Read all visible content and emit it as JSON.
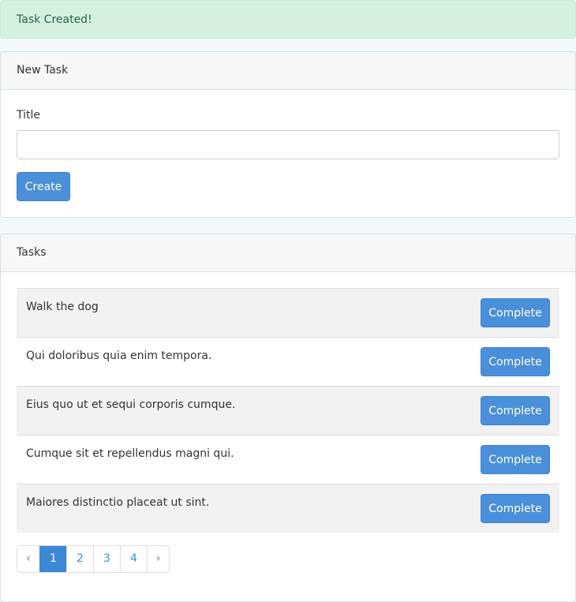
{
  "alert": {
    "text": "Task Created!"
  },
  "new_task": {
    "heading": "New Task",
    "title_label": "Title",
    "title_value": "",
    "title_placeholder": "",
    "create_label": "Create"
  },
  "tasks_panel": {
    "heading": "Tasks",
    "items": [
      {
        "title": "Walk the dog",
        "action": "Complete"
      },
      {
        "title": "Qui doloribus quia enim tempora.",
        "action": "Complete"
      },
      {
        "title": "Eius quo ut et sequi corporis cumque.",
        "action": "Complete"
      },
      {
        "title": "Cumque sit et repellendus magni qui.",
        "action": "Complete"
      },
      {
        "title": "Maiores distinctio placeat ut sint.",
        "action": "Complete"
      }
    ]
  },
  "pagination": {
    "prev": "‹",
    "pages": [
      "1",
      "2",
      "3",
      "4"
    ],
    "current": "1",
    "next": "›"
  }
}
